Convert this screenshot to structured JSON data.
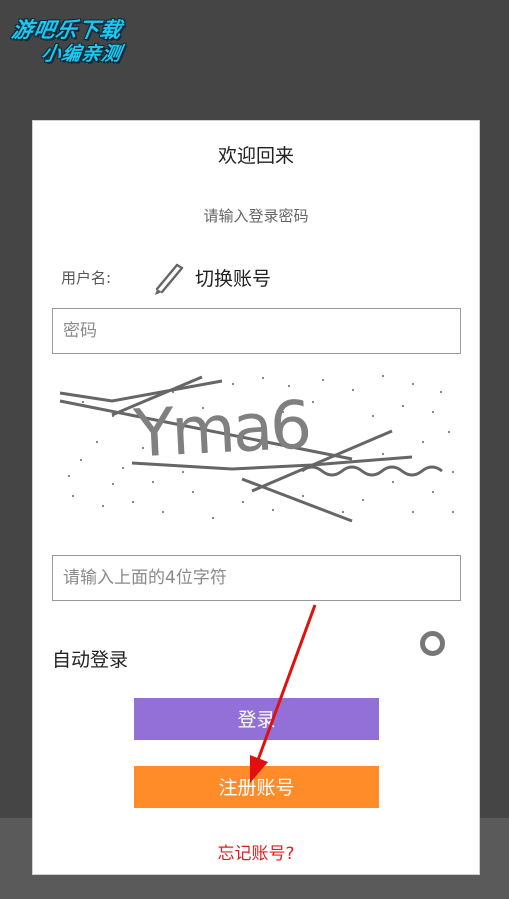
{
  "watermark": {
    "line1": "游吧乐下载",
    "line2": "小编亲测"
  },
  "dialog": {
    "title": "欢迎回来",
    "subtitle": "请输入登录密码",
    "username_label": "用户名:",
    "switch_account": "切换账号",
    "password_placeholder": "密码",
    "captcha_text": "Yma6",
    "captcha_placeholder": "请输入上面的4位字符",
    "auto_login_label": "自动登录",
    "login_button": "登录",
    "register_button": "注册账号",
    "forgot_link": "忘记账号?"
  },
  "icons": {
    "edit": "pencil-icon",
    "toggle": "radio-ring-icon"
  },
  "colors": {
    "login": "#9270d8",
    "register": "#ff8c28",
    "forgot": "#e02020",
    "annotation": "#e01010"
  }
}
